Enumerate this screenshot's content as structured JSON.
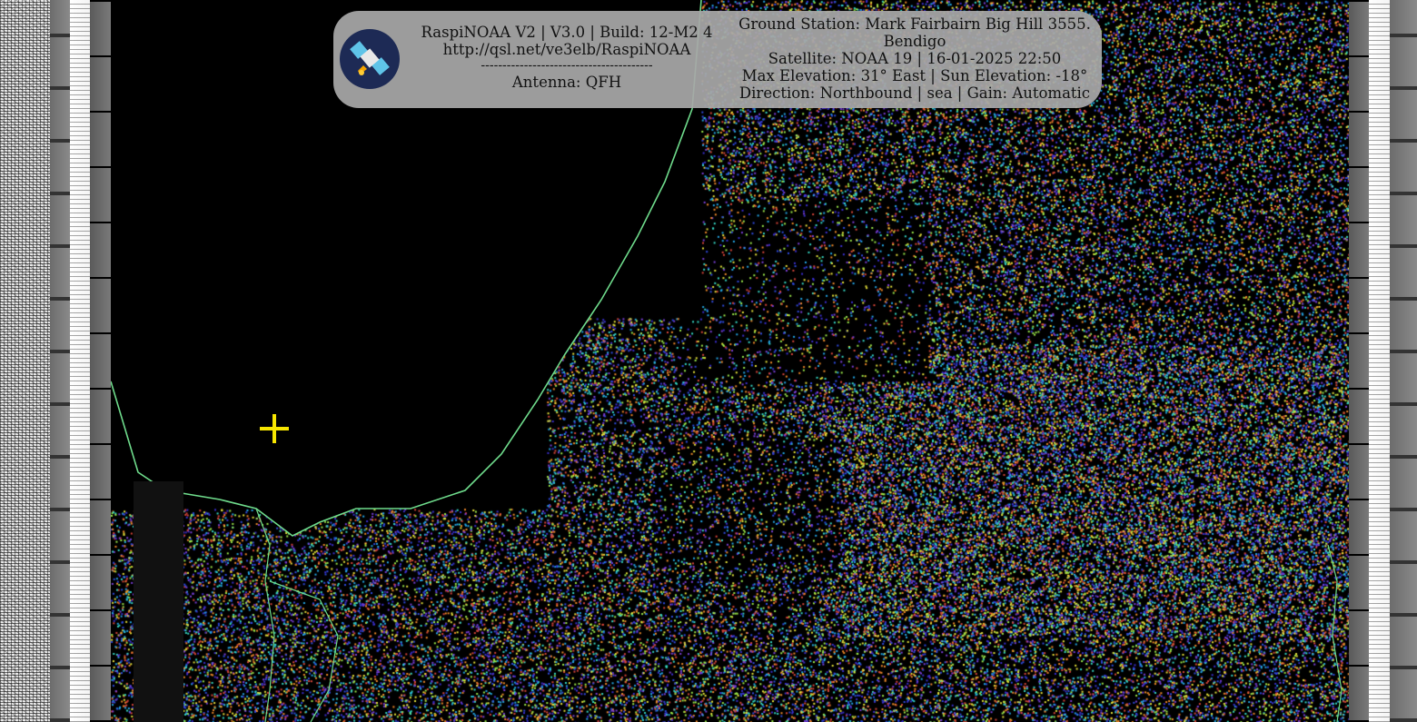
{
  "overlay": {
    "left": {
      "title": "RaspiNOAA V2 | V3.0 | Build: 12-M2 4",
      "url": "http://qsl.net/ve3elb/RaspiNOAA",
      "separator": "----------------------------------------",
      "antenna": "Antenna: QFH"
    },
    "right": {
      "ground_station_line1": "Ground Station: Mark Fairbairn Big Hill 3555.",
      "ground_station_line2": "Bendigo",
      "satellite": "Satellite: NOAA 19 | 16-01-2025 22:50",
      "elevation": "Max Elevation: 31° East | Sun Elevation: -18°",
      "direction": "Direction: Northbound | sea | Gain: Automatic"
    }
  },
  "icons": {
    "logo": "satellite-logo-icon",
    "crosshair": "crosshair-marker-icon"
  },
  "colors": {
    "panel_bg": "#a8a8a8",
    "crosshair": "#f7e600",
    "coastline": "#6fdc8c",
    "logo_bg": "#1d2a55"
  }
}
